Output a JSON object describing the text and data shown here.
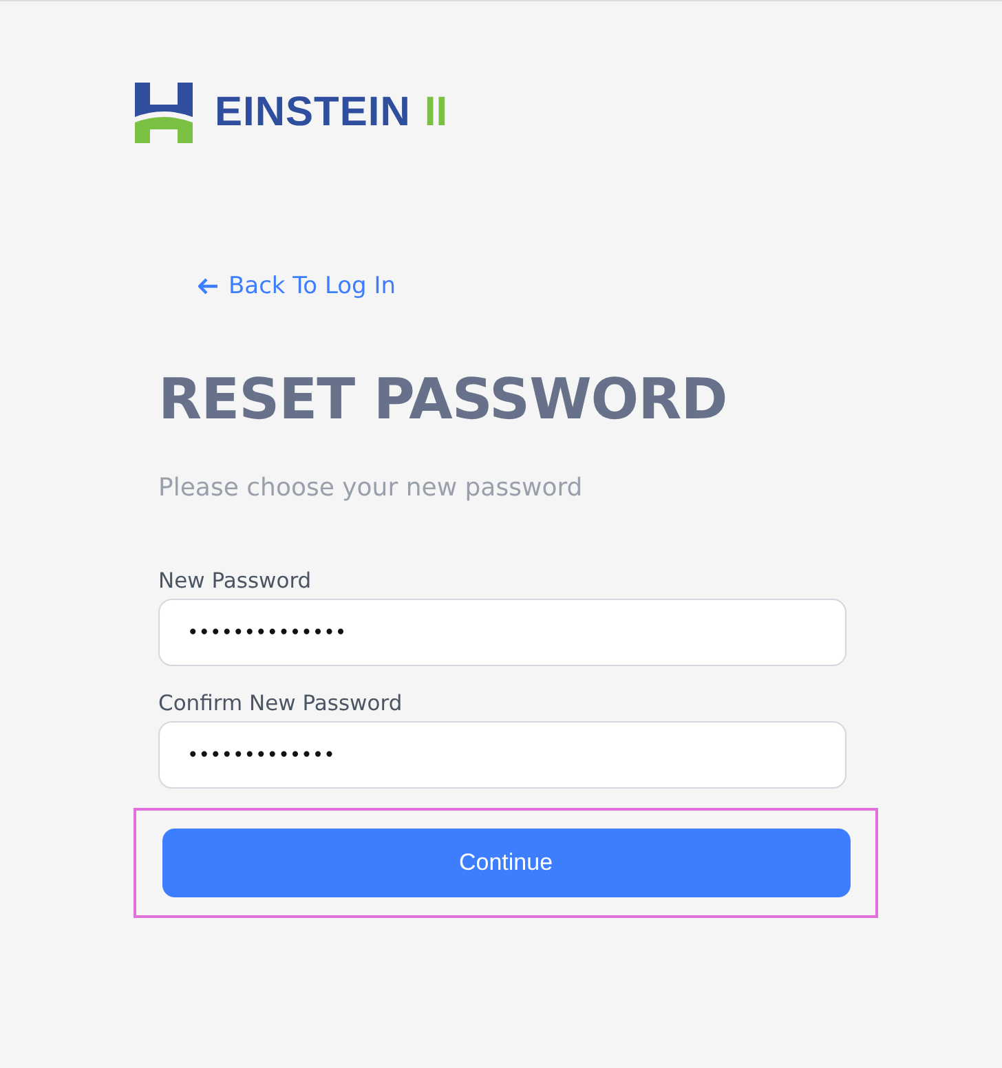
{
  "logo": {
    "name": "EINSTEIN",
    "suffix": "II"
  },
  "back_link": {
    "label": "Back To Log In"
  },
  "title": "RESET PASSWORD",
  "subtitle": "Please choose your new password",
  "fields": [
    {
      "label": "New Password",
      "value": "••••••••••••••"
    },
    {
      "label": "Confirm New Password",
      "value": "•••••••••••••"
    }
  ],
  "submit_button": {
    "label": "Continue",
    "highlighted": true
  }
}
